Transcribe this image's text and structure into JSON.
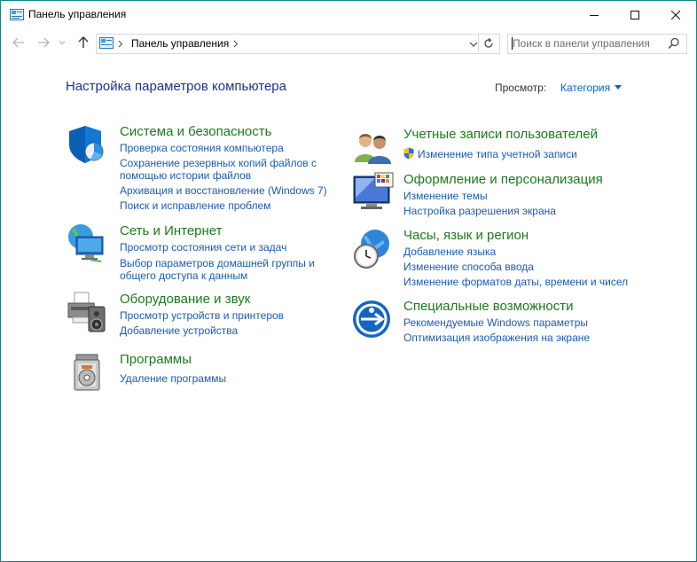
{
  "window": {
    "title": "Панель управления",
    "colors": {
      "border": "#0b8a80",
      "heading": "#1e3287",
      "category": "#1b7a1b",
      "link": "#1a5bb5"
    }
  },
  "nav": {
    "address_text": "Панель управления",
    "search_placeholder": "Поиск в панели управления"
  },
  "main": {
    "page_title": "Настройка параметров компьютера",
    "view_by_label": "Просмотр:",
    "view_by_value": "Категория"
  },
  "categories": [
    {
      "icon": "shield-icon",
      "title": "Система и безопасность",
      "links": [
        "Проверка состояния компьютера",
        "Сохранение резервных копий файлов с",
        "помощью истории файлов",
        "Архивация и восстановление (Windows 7)",
        "Поиск и исправление проблем"
      ]
    },
    {
      "icon": "network-icon",
      "title": "Сеть и Интернет",
      "links": [
        "Просмотр состояния сети и задач",
        "Выбор параметров домашней группы и",
        "общего доступа к данным"
      ]
    },
    {
      "icon": "printer-icon",
      "title": "Оборудование и звук",
      "links": [
        "Просмотр устройств и принтеров",
        "Добавление устройства"
      ]
    },
    {
      "icon": "programs-icon",
      "title": "Программы",
      "links": [
        "Удаление программы"
      ]
    },
    {
      "icon": "users-icon",
      "title": "Учетные записи пользователей",
      "links": [
        "Изменение типа учетной записи"
      ]
    },
    {
      "icon": "display-icon",
      "title": "Оформление и персонализация",
      "links": [
        "Изменение темы",
        "Настройка разрешения экрана"
      ]
    },
    {
      "icon": "clock-globe-icon",
      "title": "Часы, язык и регион",
      "links": [
        "Добавление языка",
        "Изменение способа ввода",
        "Изменение форматов даты, времени и чисел"
      ]
    },
    {
      "icon": "accessibility-icon",
      "title": "Специальные возможности",
      "links": [
        "Рекомендуемые Windows параметры",
        "Оптимизация изображения на экране"
      ]
    }
  ]
}
